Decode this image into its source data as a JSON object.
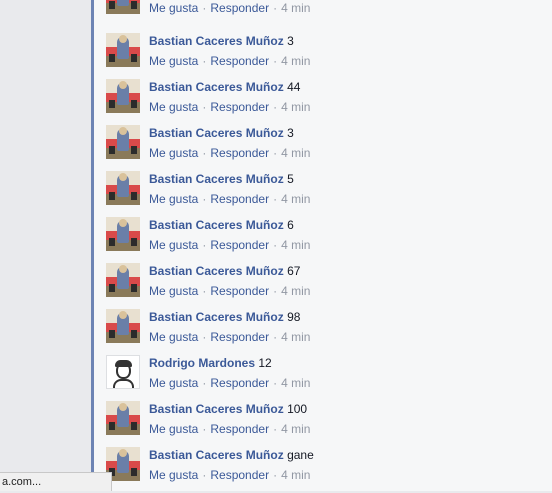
{
  "actions": {
    "like": "Me gusta",
    "reply": "Responder",
    "separator": "·"
  },
  "comments": [
    {
      "author": "",
      "text": "",
      "time": "4 min",
      "avatar": "bastian-avatar"
    },
    {
      "author": "Bastian Caceres Muñoz",
      "text": "3",
      "time": "4 min",
      "avatar": "bastian-avatar"
    },
    {
      "author": "Bastian Caceres Muñoz",
      "text": "44",
      "time": "4 min",
      "avatar": "bastian-avatar"
    },
    {
      "author": "Bastian Caceres Muñoz",
      "text": "3",
      "time": "4 min",
      "avatar": "bastian-avatar"
    },
    {
      "author": "Bastian Caceres Muñoz",
      "text": "5",
      "time": "4 min",
      "avatar": "bastian-avatar"
    },
    {
      "author": "Bastian Caceres Muñoz",
      "text": "6",
      "time": "4 min",
      "avatar": "bastian-avatar"
    },
    {
      "author": "Bastian Caceres Muñoz",
      "text": "67",
      "time": "4 min",
      "avatar": "bastian-avatar"
    },
    {
      "author": "Bastian Caceres Muñoz",
      "text": "98",
      "time": "4 min",
      "avatar": "bastian-avatar"
    },
    {
      "author": "Rodrigo Mardones",
      "text": "12",
      "time": "4 min",
      "avatar": "rodrigo-avatar"
    },
    {
      "author": "Bastian Caceres Muñoz",
      "text": "100",
      "time": "4 min",
      "avatar": "bastian-avatar"
    },
    {
      "author": "Bastian Caceres Muñoz",
      "text": "gane",
      "time": "4 min",
      "avatar": "bastian-avatar"
    }
  ],
  "status_bar": {
    "text": "a.com..."
  }
}
